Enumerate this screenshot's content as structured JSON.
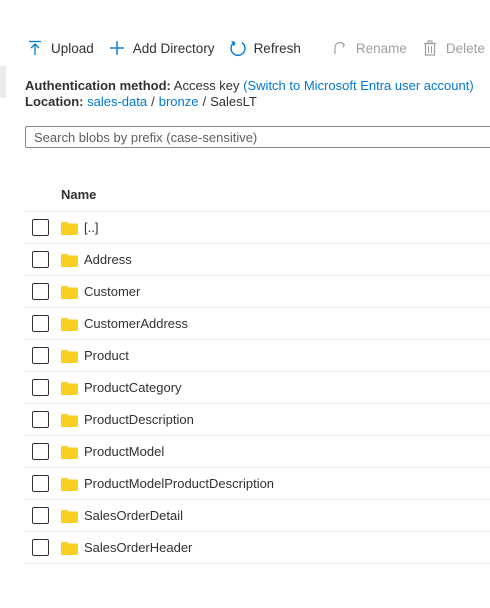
{
  "toolbar": {
    "upload": "Upload",
    "add_directory": "Add Directory",
    "refresh": "Refresh",
    "rename": "Rename",
    "delete": "Delete"
  },
  "auth": {
    "label": "Authentication method:",
    "value": "Access key",
    "switch_link": "(Switch to Microsoft Entra user account)"
  },
  "location": {
    "label": "Location:",
    "crumbs": [
      "sales-data",
      "bronze",
      "SalesLT"
    ],
    "separator": "/"
  },
  "search": {
    "placeholder": "Search blobs by prefix (case-sensitive)",
    "value": ""
  },
  "table": {
    "header_name": "Name",
    "rows": [
      "[..]",
      "Address",
      "Customer",
      "CustomerAddress",
      "Product",
      "ProductCategory",
      "ProductDescription",
      "ProductModel",
      "ProductModelProductDescription",
      "SalesOrderDetail",
      "SalesOrderHeader"
    ]
  },
  "colors": {
    "accent": "#0078d4",
    "folder": "#f8d021",
    "disabled": "#a19f9d"
  },
  "icons": {
    "upload": "upload-icon",
    "add": "plus-icon",
    "refresh": "refresh-icon",
    "rename": "rename-icon",
    "delete": "trash-icon",
    "folder": "folder-icon"
  }
}
